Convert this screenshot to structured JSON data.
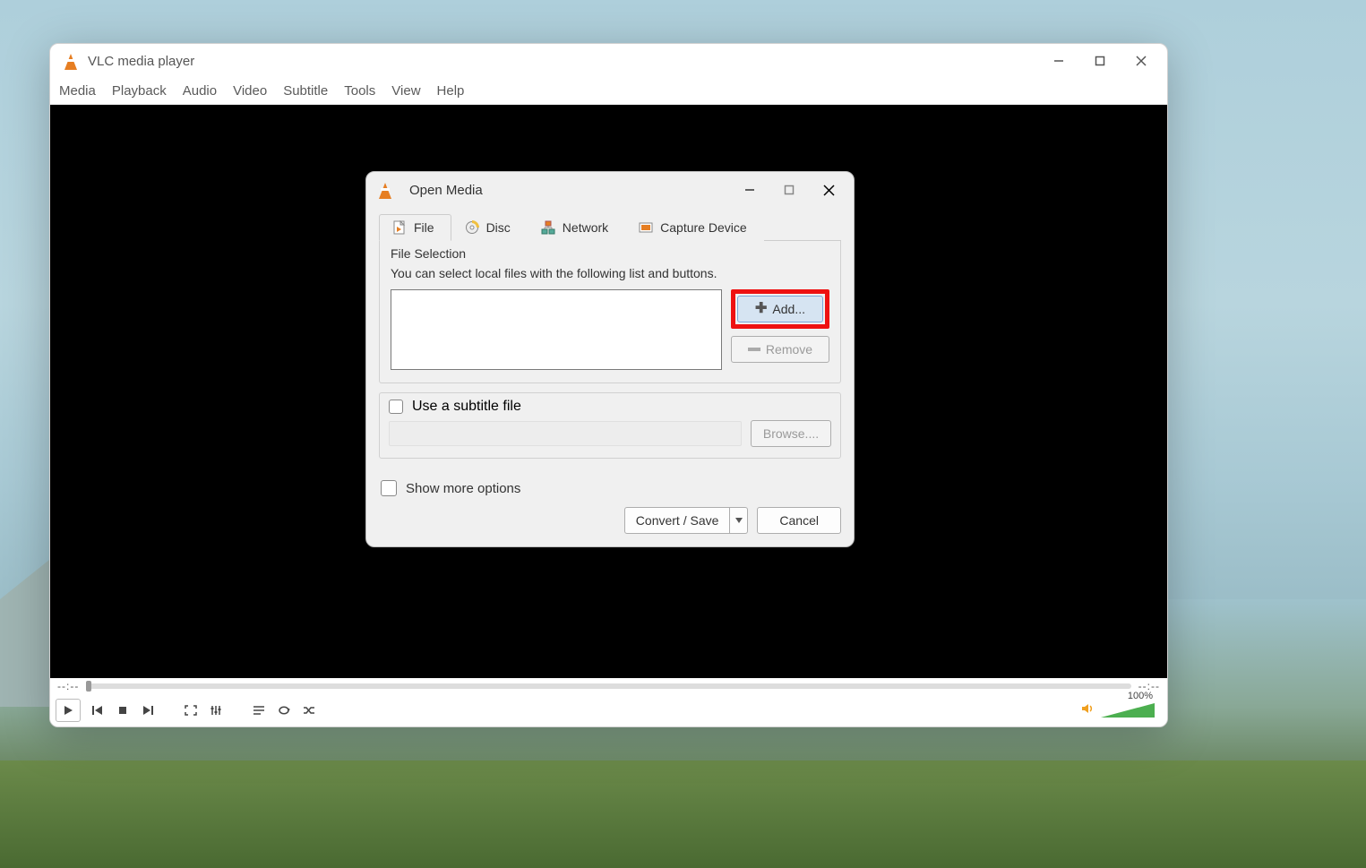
{
  "main_window": {
    "title": "VLC media player",
    "menu": [
      "Media",
      "Playback",
      "Audio",
      "Video",
      "Subtitle",
      "Tools",
      "View",
      "Help"
    ],
    "time_elapsed": "--:--",
    "time_total": "--:--",
    "volume_label": "100%"
  },
  "dialog": {
    "title": "Open Media",
    "tabs": {
      "file": "File",
      "disc": "Disc",
      "network": "Network",
      "capture": "Capture Device",
      "active": "file"
    },
    "file_section": {
      "group_title": "File Selection",
      "help": "You can select local files with the following list and buttons.",
      "add_label": "Add...",
      "remove_label": "Remove"
    },
    "subtitle_section": {
      "checkbox_label": "Use a subtitle file",
      "browse_label": "Browse...."
    },
    "more_label": "Show more options",
    "convert_label": "Convert / Save",
    "cancel_label": "Cancel"
  },
  "highlight": {
    "target": "add-button",
    "color": "#e11"
  }
}
